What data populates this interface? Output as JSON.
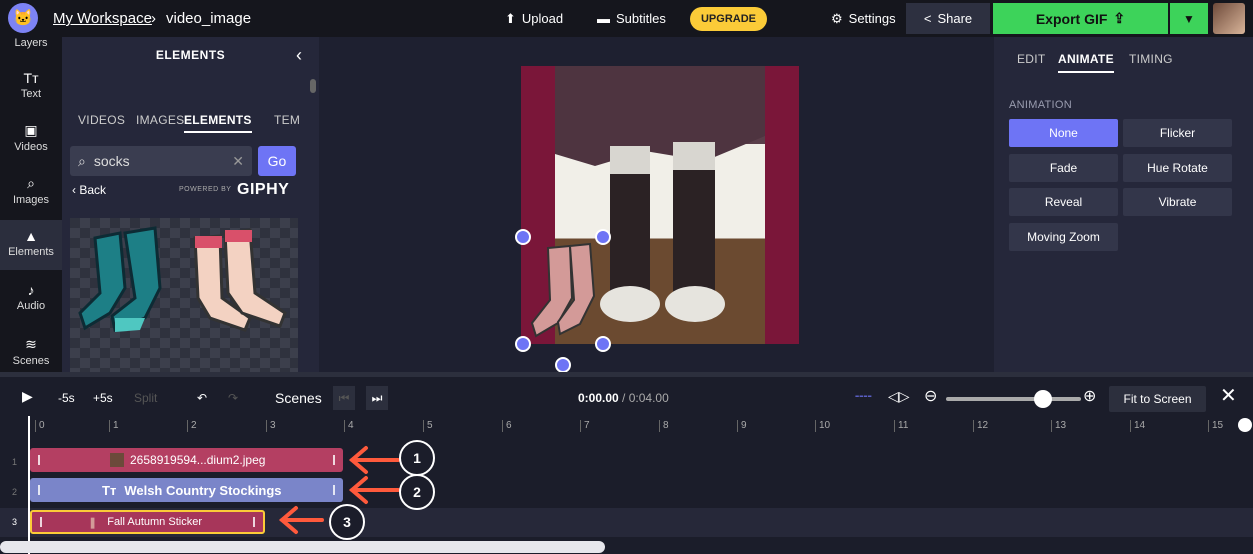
{
  "topbar": {
    "workspace": "My Workspace",
    "separator": "›",
    "project": "video_image",
    "upload": "Upload",
    "subtitles": "Subtitles",
    "upgrade": "UPGRADE",
    "settings": "Settings",
    "share": "Share",
    "export": "Export GIF"
  },
  "rail": [
    {
      "label": "Layers",
      "icon": "layers-icon"
    },
    {
      "label": "Text",
      "icon": "text-icon"
    },
    {
      "label": "Videos",
      "icon": "video-icon"
    },
    {
      "label": "Images",
      "icon": "search-icon"
    },
    {
      "label": "Elements",
      "icon": "shapes-icon"
    },
    {
      "label": "Audio",
      "icon": "music-note-icon"
    },
    {
      "label": "Scenes",
      "icon": "layers-stack-icon"
    }
  ],
  "panel": {
    "title": "ELEMENTS",
    "tabs": [
      "VIDEOS",
      "IMAGES",
      "ELEMENTS",
      "TEM"
    ],
    "active_tab": "ELEMENTS",
    "search_value": "socks",
    "go": "Go",
    "back": "‹ Back",
    "powered_by": "POWERED BY",
    "brand": "GIPHY"
  },
  "props": {
    "tabs": [
      "EDIT",
      "ANIMATE",
      "TIMING"
    ],
    "active_tab": "ANIMATE",
    "section": "ANIMATION",
    "animations": [
      "None",
      "Flicker",
      "Fade",
      "Hue Rotate",
      "Reveal",
      "Vibrate",
      "Moving Zoom"
    ],
    "selected": "None"
  },
  "timeline": {
    "back5": "-5s",
    "fwd5": "+5s",
    "split": "Split",
    "scenes": "Scenes",
    "time_current": "0:00.00",
    "time_total": "/ 0:04.00",
    "fit": "Fit to Screen",
    "ticks": [
      "0",
      "1",
      "2",
      "3",
      "4",
      "5",
      "6",
      "7",
      "8",
      "9",
      "10",
      "11",
      "12",
      "13",
      "14",
      "15"
    ],
    "tracks": [
      {
        "num": "1",
        "label": "2658919594...dium2.jpeg",
        "color": "#b43f62",
        "callout": "1"
      },
      {
        "num": "2",
        "label": "Welsh Country Stockings",
        "color": "#7a85c9",
        "callout": "2"
      },
      {
        "num": "3",
        "label": "Fall Autumn Sticker",
        "color": "#a7365a",
        "callout": "3"
      }
    ]
  },
  "colors": {
    "accent": "#6e74f5",
    "export": "#3dd35a",
    "upgrade": "#fbcb38",
    "callout_arrow": "#ff5a3c"
  }
}
